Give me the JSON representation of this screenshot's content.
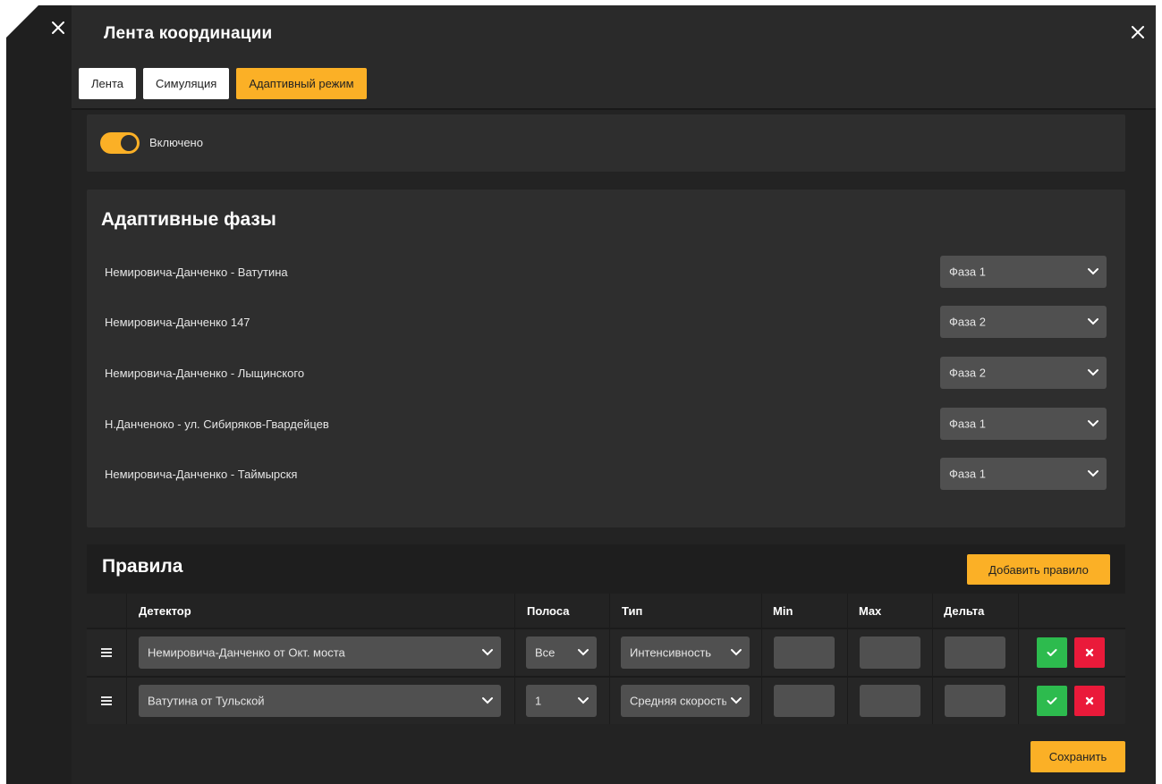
{
  "window": {
    "title": "Лента координации",
    "close_icon": "close-icon",
    "side_close_icon": "close-icon"
  },
  "tabs": [
    {
      "label": "Лента",
      "active": false
    },
    {
      "label": "Симуляция",
      "active": false
    },
    {
      "label": "Адаптивный режим",
      "active": true
    }
  ],
  "adaptive": {
    "enabled": true,
    "enabled_label": "Включено"
  },
  "phases": {
    "title": "Адаптивные фазы",
    "items": [
      {
        "name": "Немировича-Данченко - Ватутина",
        "phase": "Фаза 1"
      },
      {
        "name": "Немировича-Данченко 147",
        "phase": "Фаза 2"
      },
      {
        "name": "Немировича-Данченко - Лыщинского",
        "phase": "Фаза 2"
      },
      {
        "name": "Н.Данченоко - ул. Сибиряков-Гвардейцев",
        "phase": "Фаза 1"
      },
      {
        "name": "Немировича-Данченко - Таймырскя",
        "phase": "Фаза 1"
      }
    ]
  },
  "rules": {
    "title": "Правила",
    "add_label": "Добавить правило",
    "columns": {
      "detector": "Детектор",
      "lane": "Полоса",
      "type": "Тип",
      "min": "Min",
      "max": "Max",
      "delta": "Дельта"
    },
    "rows": [
      {
        "detector": "Немировича-Данченко от Окт. моста",
        "lane": "Все",
        "type": "Интенсивность",
        "min": "",
        "max": "",
        "delta": ""
      },
      {
        "detector": "Ватутина от Тульской",
        "lane": "1",
        "type": "Средняя скорость",
        "min": "",
        "max": "",
        "delta": ""
      }
    ]
  },
  "footer": {
    "save_label": "Сохранить"
  },
  "colors": {
    "accent": "#fbb026",
    "confirm": "#2dbb4e",
    "delete": "#ea1a3a",
    "background": "#232323"
  }
}
